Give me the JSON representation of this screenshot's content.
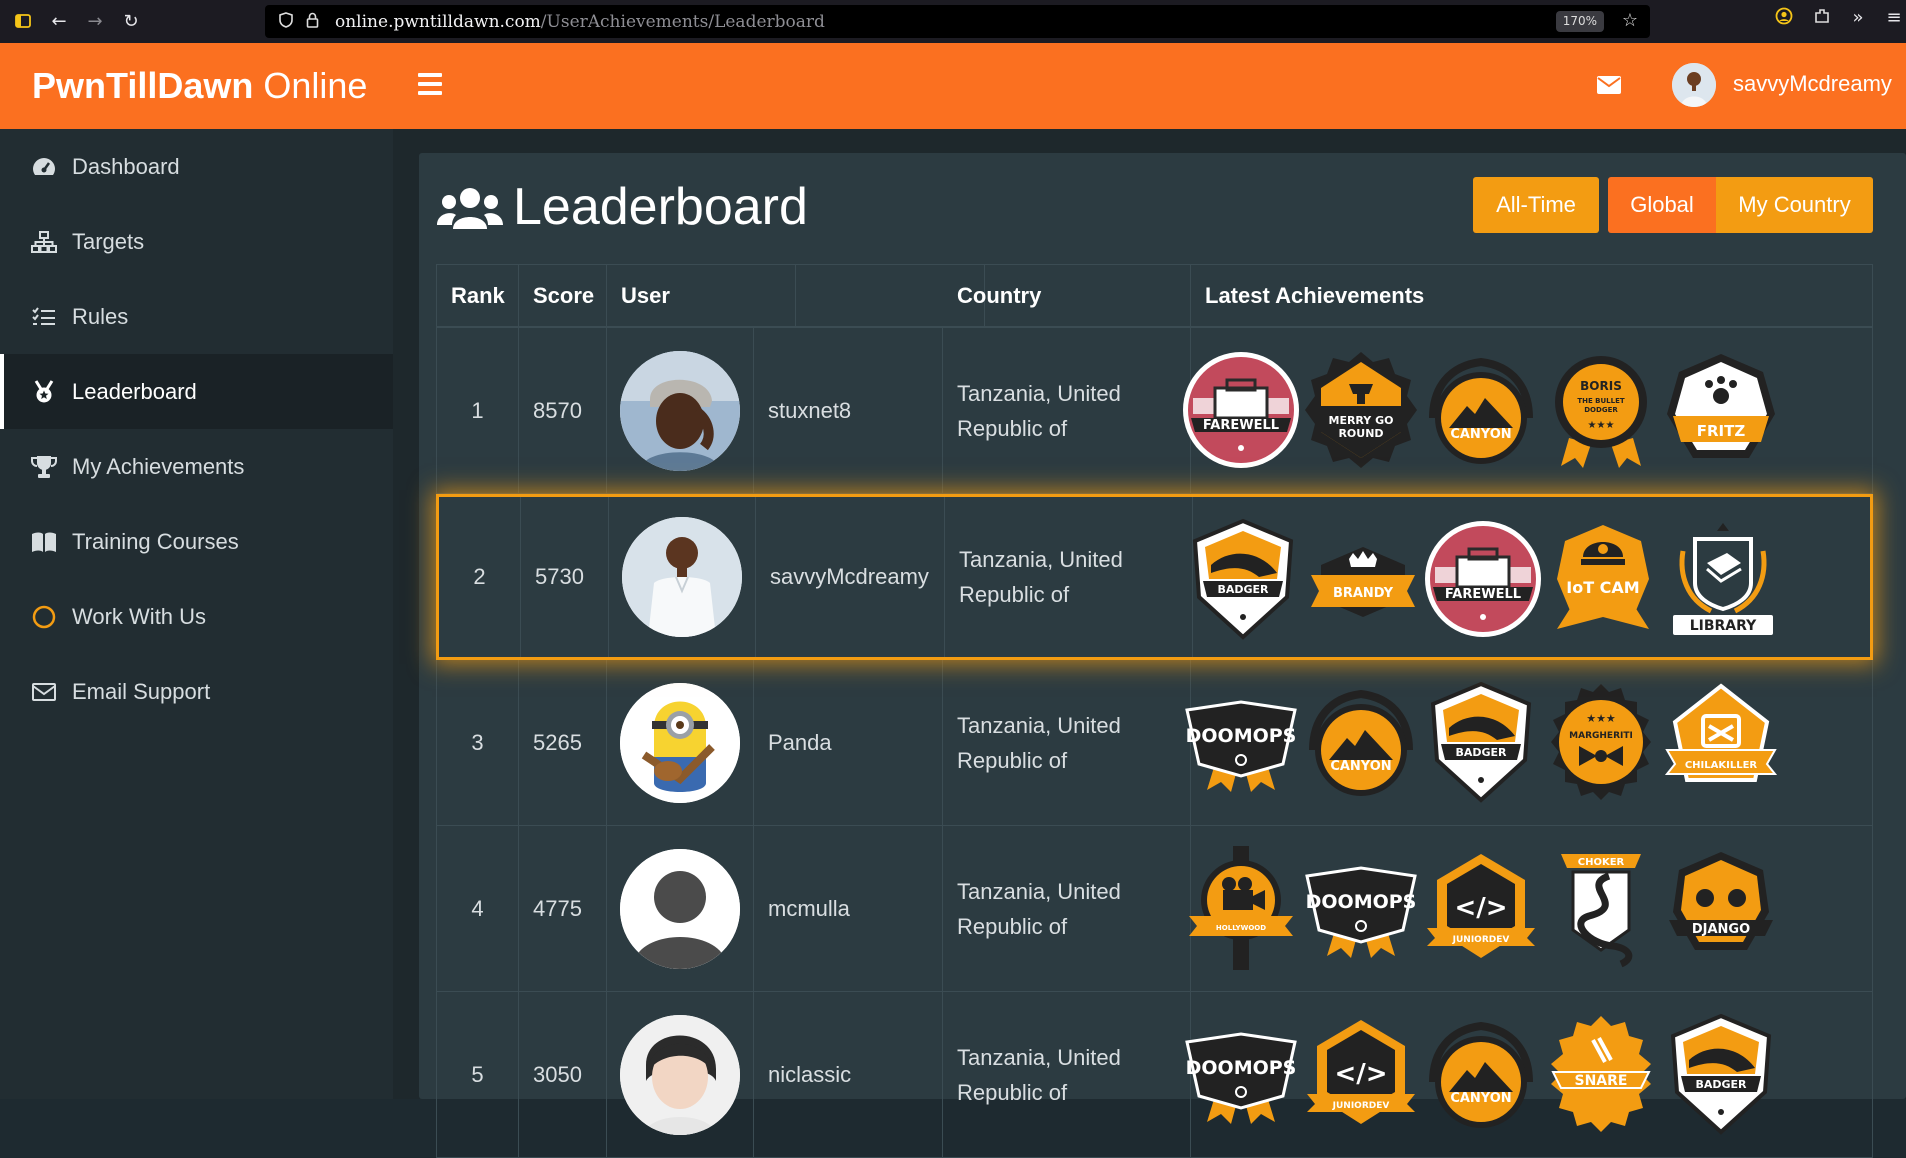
{
  "browser": {
    "url_host": "online.pwntilldawn.com",
    "url_path": "/UserAchievements/Leaderboard",
    "zoom": "170%",
    "icons": [
      "sidebar-toggle-icon",
      "back-arrow-icon",
      "forward-arrow-icon",
      "reload-icon",
      "shield-icon",
      "lock-icon",
      "bookmark-star-icon",
      "account-icon",
      "extensions-icon",
      "overflow-icon",
      "menu-icon"
    ]
  },
  "header": {
    "brand_bold": "PwnTillDawn",
    "brand_light": " Online",
    "username": "savvyMcdreamy"
  },
  "sidebar": {
    "items": [
      {
        "label": "Dashboard",
        "icon": "speedometer-icon"
      },
      {
        "label": "Targets",
        "icon": "sitemap-icon"
      },
      {
        "label": "Rules",
        "icon": "list-icon"
      },
      {
        "label": "Leaderboard",
        "icon": "medal-icon",
        "active": true
      },
      {
        "label": "My Achievements",
        "icon": "trophy-icon"
      },
      {
        "label": "Training Courses",
        "icon": "book-icon"
      },
      {
        "label": "Work With Us",
        "icon": "circle-icon"
      },
      {
        "label": "Email Support",
        "icon": "envelope-icon"
      }
    ]
  },
  "main": {
    "title": "Leaderboard",
    "filters": {
      "all_time": "All-Time",
      "global": "Global",
      "my_country": "My Country"
    },
    "columns": {
      "rank": "Rank",
      "score": "Score",
      "user": "User",
      "country": "Country",
      "achievements": "Latest Achievements"
    },
    "rows": [
      {
        "rank": "1",
        "score": "8570",
        "user": "stuxnet8",
        "country": "Tanzania, United Republic of",
        "badges": [
          "FAREWELL",
          "MERRY GO ROUND",
          "CANYON",
          "BORIS THE BULLET DODGER",
          "FRITZ"
        ]
      },
      {
        "rank": "2",
        "score": "5730",
        "user": "savvyMcdreamy",
        "country": "Tanzania, United Republic of",
        "current_user": true,
        "badges": [
          "BADGER",
          "BRANDY",
          "FAREWELL",
          "IoT CAM",
          "LIBRARY"
        ]
      },
      {
        "rank": "3",
        "score": "5265",
        "user": "Panda",
        "country": "Tanzania, United Republic of",
        "badges": [
          "DOOMOPS",
          "CANYON",
          "BADGER",
          "MARGHERITI",
          "CHILAKILLER"
        ]
      },
      {
        "rank": "4",
        "score": "4775",
        "user": "mcmulla",
        "country": "Tanzania, United Republic of",
        "badges": [
          "HOLLYWOOD",
          "DOOMOPS",
          "JUNIORDEV",
          "CHOKER",
          "DJANGO"
        ]
      },
      {
        "rank": "5",
        "score": "3050",
        "user": "niclassic",
        "country": "Tanzania, United Republic of",
        "badges": [
          "DOOMOPS",
          "JUNIORDEV",
          "CANYON",
          "SNARE",
          "BADGER"
        ]
      }
    ]
  },
  "colors": {
    "accent": "#fb7020",
    "warning": "#f39c12",
    "sidebar": "#222d32",
    "panel": "#2c3b41"
  }
}
